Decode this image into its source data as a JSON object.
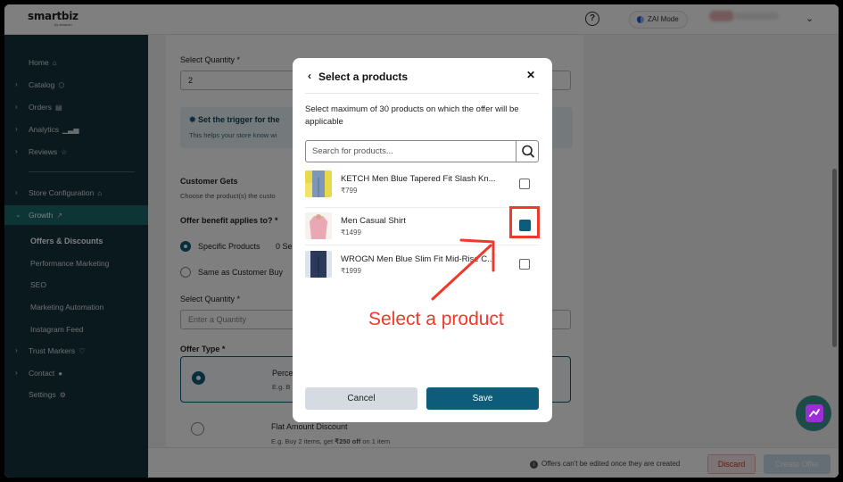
{
  "topbar": {
    "logo_text": "smartbiz",
    "logo_sub": "by amazon",
    "help_icon": "question-circle-icon",
    "zai_label": "ZAI Mode"
  },
  "sidebar": {
    "items": [
      {
        "label": "Home",
        "icon": "home-icon"
      },
      {
        "label": "Catalog",
        "icon": "box-icon"
      },
      {
        "label": "Orders",
        "icon": "clipboard-icon"
      },
      {
        "label": "Analytics",
        "icon": "bar-chart-icon"
      },
      {
        "label": "Reviews",
        "icon": "star-icon"
      },
      {
        "label": "Store Configuration",
        "icon": "store-icon"
      },
      {
        "label": "Growth",
        "icon": "trend-up-icon"
      },
      {
        "label": "Offers & Discounts"
      },
      {
        "label": "Performance Marketing"
      },
      {
        "label": "SEO"
      },
      {
        "label": "Marketing Automation"
      },
      {
        "label": "Instagram Feed"
      },
      {
        "label": "Trust Markers",
        "icon": "heart-shield-icon"
      },
      {
        "label": "Contact",
        "icon": "chat-icon"
      },
      {
        "label": "Settings",
        "icon": "gear-icon"
      }
    ]
  },
  "main": {
    "select_qty_label": "Select Quantity *",
    "select_qty_value": "2",
    "trigger_title": "Set the trigger for the",
    "trigger_sub": "This helps your store know wi",
    "customer_gets_title": "Customer Gets",
    "customer_gets_sub": "Choose the product(s) the custo",
    "applies_label": "Offer benefit applies to? *",
    "radio_specific": "Specific Products",
    "radio_specific_suffix": "0 Se",
    "radio_same": "Same as Customer Buy",
    "select_qty2_label": "Select Quantity *",
    "select_qty2_placeholder": "Enter a Quantity",
    "offer_type_label": "Offer Type *",
    "offer_opt1_title": "Perce",
    "offer_opt1_sub": "E.g. B",
    "offer_opt2_title": "Flat Amount Discount",
    "offer_opt2_sub_pre": "E.g. Buy 2 items, get ",
    "offer_opt2_sub_bold": "₹250 off",
    "offer_opt2_sub_post": " on 1 item"
  },
  "bottombar": {
    "info_text": "Offers can't be edited once they are created",
    "discard_label": "Discard",
    "create_label": "Create Offer"
  },
  "modal": {
    "title": "Select a products",
    "description": "Select maximum of 30 products on which the offer will be applicable",
    "search_placeholder": "Search for products...",
    "products": [
      {
        "name": "KETCH Men Blue Tapered Fit Slash Kn...",
        "price": "₹799",
        "checked": false
      },
      {
        "name": "Men Casual Shirt",
        "price": "₹1499",
        "checked": true
      },
      {
        "name": "WROGN Men Blue Slim Fit Mid-Rise C...",
        "price": "₹1999",
        "checked": false
      }
    ],
    "cancel_label": "Cancel",
    "save_label": "Save"
  },
  "annotation": {
    "text": "Select a product",
    "color": "#f0382b"
  },
  "colors": {
    "accent": "#0c5c7a",
    "sidebar_bg": "#15323c",
    "sidebar_active": "#1b6b6b"
  }
}
